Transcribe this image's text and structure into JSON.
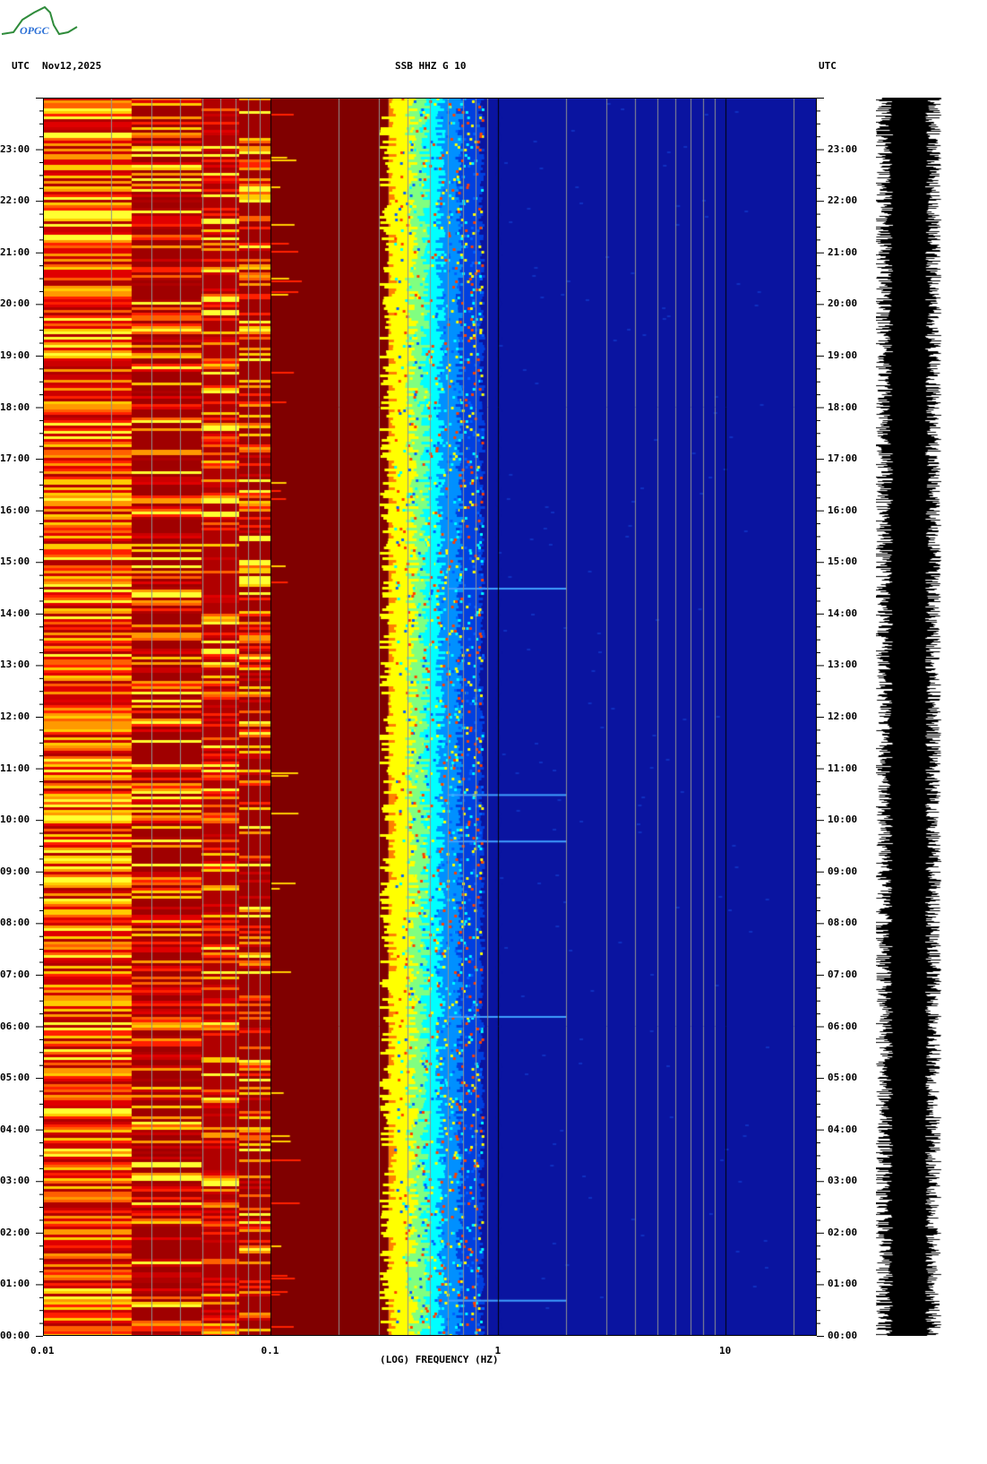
{
  "header": {
    "left_tz": "UTC",
    "date": "Nov12,2025",
    "station": "SSB HHZ G 10",
    "right_tz": "UTC",
    "logo": "OPGC"
  },
  "chart_data": {
    "type": "heatmap",
    "title": "SSB HHZ G 10",
    "xlabel": "(LOG) FREQUENCY (HZ)",
    "ylabel": "UTC",
    "xscale": "log",
    "xlim": [
      0.01,
      25
    ],
    "xticks": [
      "0.01",
      "0.1",
      "1",
      "10"
    ],
    "ylim_hours": [
      0,
      24
    ],
    "yticks": [
      "00:00",
      "01:00",
      "02:00",
      "03:00",
      "04:00",
      "05:00",
      "06:00",
      "07:00",
      "08:00",
      "09:00",
      "10:00",
      "11:00",
      "12:00",
      "13:00",
      "14:00",
      "15:00",
      "16:00",
      "17:00",
      "18:00",
      "19:00",
      "20:00",
      "21:00",
      "22:00",
      "23:00"
    ],
    "bands": [
      {
        "from_hz": 0.01,
        "to_hz": 0.1,
        "level": "high, striped red/orange/yellow"
      },
      {
        "from_hz": 0.1,
        "to_hz": 0.33,
        "level": "saturated dark red"
      },
      {
        "from_hz": 0.33,
        "to_hz": 0.9,
        "level": "microseism peak, yellow to cyan"
      },
      {
        "from_hz": 0.9,
        "to_hz": 25,
        "level": "low, blue"
      }
    ],
    "events_utc_hours": [
      0.7,
      6.2,
      9.6,
      10.5,
      14.5
    ]
  }
}
